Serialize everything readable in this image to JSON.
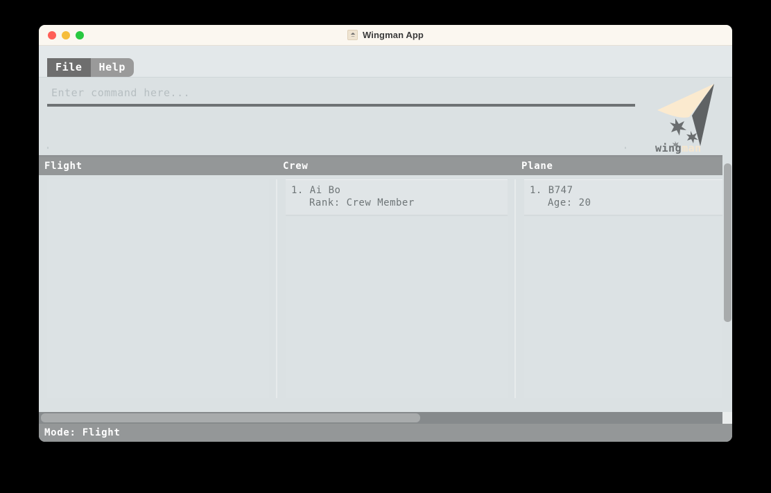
{
  "window": {
    "title": "Wingman App",
    "title_icon": "app-icon",
    "traffic_lights": [
      {
        "name": "close-button",
        "color": "#ff5f57"
      },
      {
        "name": "minimize-button",
        "color": "#f6bd3b"
      },
      {
        "name": "maximize-button",
        "color": "#28c840"
      }
    ]
  },
  "menubar": {
    "items": [
      {
        "label": "File",
        "state": "active"
      },
      {
        "label": "Help",
        "state": "inactive"
      }
    ]
  },
  "command": {
    "value": "",
    "placeholder": "Enter command here..."
  },
  "logo": {
    "word_first": "wing",
    "word_second": "man",
    "color_first": "#6b6f71",
    "color_second": "#f6e6cd",
    "wing_light": "#fbeacf",
    "wing_dark": "#5f6264"
  },
  "table": {
    "headers": [
      "Flight",
      "Crew",
      "Plane"
    ],
    "columns": [
      {
        "key": "flight",
        "header": "Flight",
        "items": []
      },
      {
        "key": "crew",
        "header": "Crew",
        "items": [
          {
            "index": "1.",
            "title": "Ai Bo",
            "detail": "Rank: Crew Member"
          }
        ]
      },
      {
        "key": "plane",
        "header": "Plane",
        "items": [
          {
            "index": "1.",
            "title": "B747",
            "detail": "Age: 20"
          }
        ]
      }
    ]
  },
  "scrollbars": {
    "vertical": {
      "thumb_percent": 63
    },
    "horizontal": {
      "thumb_percent": 55
    }
  },
  "statusbar": {
    "text": "Mode: Flight"
  }
}
